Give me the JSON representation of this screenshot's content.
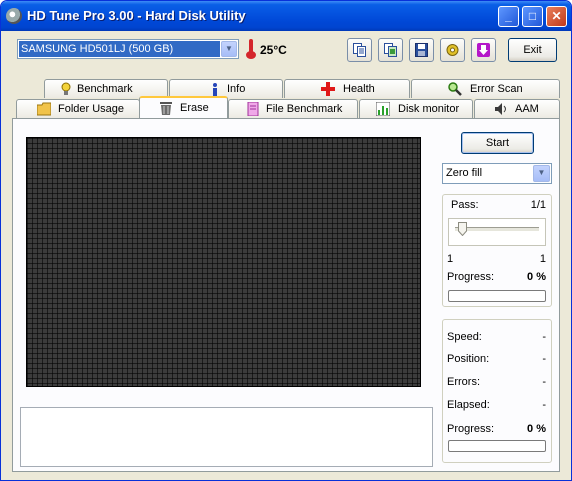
{
  "window": {
    "title": "HD Tune Pro 3.00 - Hard Disk Utility",
    "controls": {
      "minimize": "_",
      "maximize": "□",
      "close": "✕"
    }
  },
  "toolbar": {
    "drive": "SAMSUNG HD501LJ (500 GB)",
    "temperature": "25°C",
    "exit_label": "Exit",
    "icons": [
      "copy-text-icon",
      "copy-screenshot-icon",
      "save-icon",
      "options-icon",
      "download-icon"
    ]
  },
  "tabs": {
    "row1": [
      {
        "label": "Benchmark",
        "icon": "benchmark-bulb-icon"
      },
      {
        "label": "Info",
        "icon": "info-icon"
      },
      {
        "label": "Health",
        "icon": "health-cross-icon"
      },
      {
        "label": "Error Scan",
        "icon": "magnifier-icon"
      }
    ],
    "row2": [
      {
        "label": "Folder Usage",
        "icon": "folder-icon"
      },
      {
        "label": "Erase",
        "icon": "trash-icon"
      },
      {
        "label": "File Benchmark",
        "icon": "file-icon"
      },
      {
        "label": "Disk monitor",
        "icon": "chart-icon"
      },
      {
        "label": "AAM",
        "icon": "speaker-icon"
      }
    ],
    "active": "Erase"
  },
  "erase": {
    "start_label": "Start",
    "mode": "Zero fill",
    "pass_label": "Pass:",
    "pass_value": "1/1",
    "pass_slider": {
      "min": "1",
      "max": "1",
      "value": 1
    },
    "progress_label": "Progress:",
    "progress_value": "0 %",
    "progress_fraction": 0,
    "stats": {
      "speed_label": "Speed:",
      "speed_value": "-",
      "position_label": "Position:",
      "position_value": "-",
      "errors_label": "Errors:",
      "errors_value": "-",
      "elapsed_label": "Elapsed:",
      "elapsed_value": "-",
      "progress_label": "Progress:",
      "progress_value": "0 %",
      "progress_fraction": 0
    }
  },
  "colors": {
    "titlebar": "#0553e0",
    "grid_block": "#3c3c3c",
    "progress_fill": "#2fbd3a",
    "selection": "#316ac5",
    "active_tab_accent": "#ffc83c"
  }
}
